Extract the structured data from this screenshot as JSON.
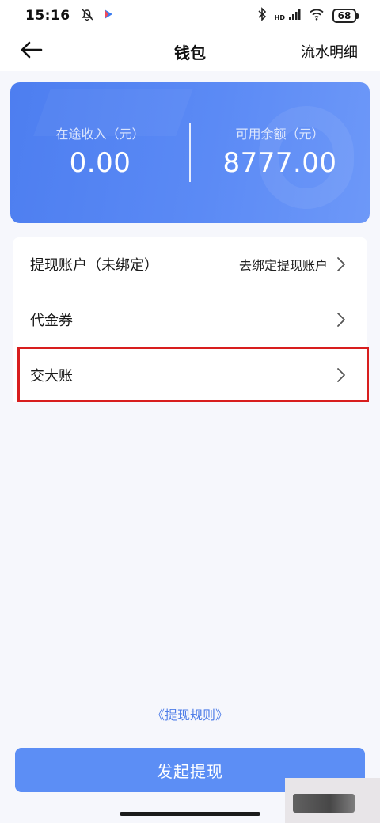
{
  "status_bar": {
    "time": "15:16",
    "network_label": "HD",
    "battery": "68"
  },
  "nav": {
    "title": "钱包",
    "right_action": "流水明细"
  },
  "balance": {
    "in_transit_label": "在途收入（元）",
    "in_transit_value": "0.00",
    "available_label": "可用余额（元）",
    "available_value": "8777.00"
  },
  "menu": {
    "items": [
      {
        "label": "提现账户（未绑定）",
        "hint": "去绑定提现账户"
      },
      {
        "label": "代金券",
        "hint": ""
      },
      {
        "label": "交大账",
        "hint": ""
      }
    ]
  },
  "rules_link": "《提现规则》",
  "withdraw_button": "发起提现",
  "colors": {
    "card_blue": "#5b8af5",
    "button_blue": "#5c8ef5",
    "link_blue": "#4e7de8",
    "highlight_red": "#d81e1e"
  }
}
